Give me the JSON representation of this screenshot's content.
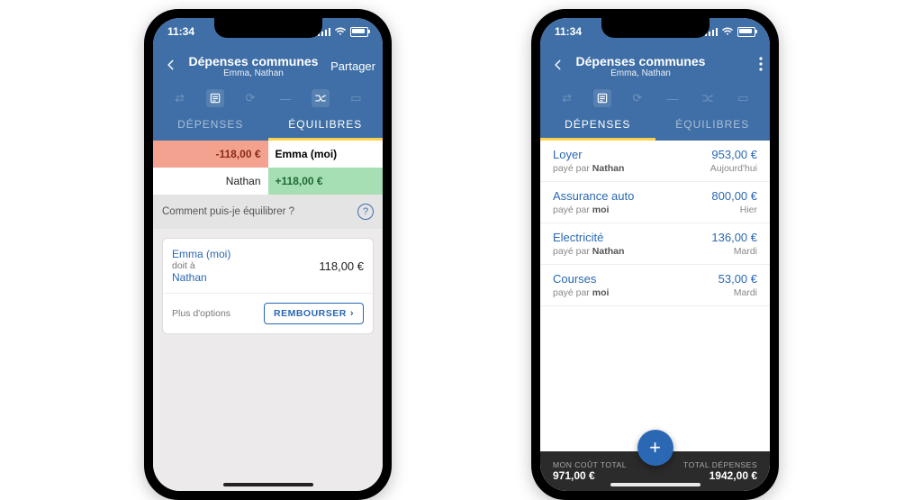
{
  "statusbar": {
    "time": "11:34"
  },
  "screen1": {
    "header": {
      "title": "Dépenses communes",
      "subtitle": "Emma, Nathan",
      "action_label": "Partager"
    },
    "tabs": {
      "expenses": "DÉPENSES",
      "balances": "ÉQUILIBRES"
    },
    "balances": {
      "me_amount": "-118,00 €",
      "me_name": "Emma (moi)",
      "other_name": "Nathan",
      "other_amount": "+118,00 €"
    },
    "question": "Comment puis-je équilibrer ?",
    "card": {
      "from": "Emma (moi)",
      "verb": "doit à",
      "to": "Nathan",
      "amount": "118,00 €",
      "more_options": "Plus d'options",
      "reimburse_label": "REMBOURSER"
    }
  },
  "screen2": {
    "header": {
      "title": "Dépenses communes",
      "subtitle": "Emma, Nathan"
    },
    "tabs": {
      "expenses": "DÉPENSES",
      "balances": "ÉQUILIBRES"
    },
    "paid_by_prefix": "payé par",
    "items": [
      {
        "title": "Loyer",
        "amount": "953,00 €",
        "payer": "Nathan",
        "date": "Aujourd'hui"
      },
      {
        "title": "Assurance auto",
        "amount": "800,00 €",
        "payer": "moi",
        "date": "Hier"
      },
      {
        "title": "Electricité",
        "amount": "136,00 €",
        "payer": "Nathan",
        "date": "Mardi"
      },
      {
        "title": "Courses",
        "amount": "53,00 €",
        "payer": "moi",
        "date": "Mardi"
      }
    ],
    "footer": {
      "my_cost_label": "MON COÛT TOTAL",
      "my_cost_value": "971,00 €",
      "total_label": "TOTAL DÉPENSES",
      "total_value": "1942,00 €"
    }
  }
}
